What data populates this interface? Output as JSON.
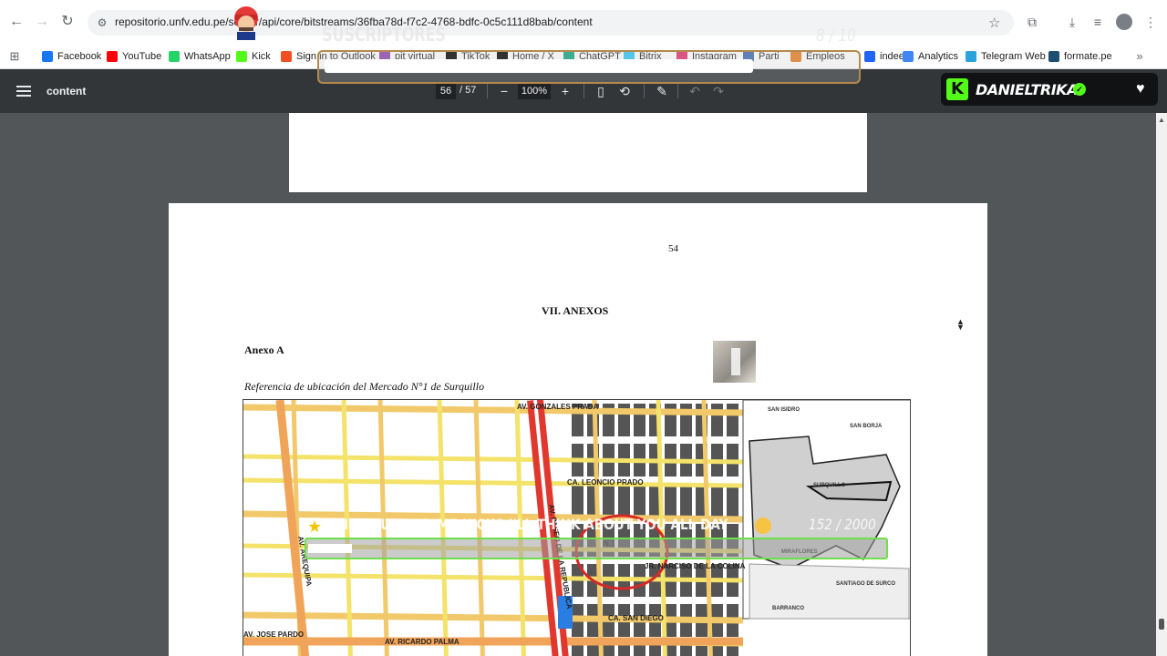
{
  "browser": {
    "url": "repositorio.unfv.edu.pe/server/api/core/bitstreams/36fba78d-f7c2-4768-bdfc-0c5c111d8bab/content",
    "bookmarks": [
      "Facebook",
      "YouTube",
      "WhatsApp",
      "Kick",
      "Sign in to Outlook",
      "pit virtual",
      "TikTok",
      "Home / X",
      "ChatGPT",
      "Bitrix",
      "Instagram",
      "Parti",
      "Empleos",
      "indeed",
      "Analytics",
      "Telegram Web",
      "formate.pe"
    ],
    "bookmark_colors": [
      "#1877f2",
      "#ff0000",
      "#25d366",
      "#53fc18",
      "#f25022",
      "#8e44ad",
      "#000000",
      "#000000",
      "#10a37f",
      "#2fc6f6",
      "#e1306c",
      "#3d6ab3",
      "#e67e22",
      "#2164f3",
      "#4285f4",
      "#2aa3df",
      "#1d4e72"
    ]
  },
  "pdf": {
    "title": "content",
    "current_page": "56",
    "total_pages": "/ 57",
    "zoom": "100%"
  },
  "document": {
    "page_number": "54",
    "section_title": "VII. ANEXOS",
    "annex_label": "Anexo A",
    "figure_caption": "Referencia de ubicación del Mercado N°1 de Surquillo"
  },
  "map": {
    "street_labels": [
      "AV. GONZALES PRADA",
      "CA. LEONCIO PRADO",
      "AV. PASEO DE LA REPUBLICA",
      "JR. NARCISO DE LA COLINA",
      "CA. SAN DIEGO",
      "AV. RICARDO PALMA",
      "AV. JOSE PARDO",
      "AV. AREQUIPA",
      "N.1"
    ],
    "district_labels": [
      "SAN ISIDRO",
      "SAN BORJA",
      "SURQUILLO",
      "MIRAFLORES",
      "SANTIAGO DE SURCO",
      "BARRANCO"
    ],
    "colors": {
      "major_road": "#e0382f",
      "avenue": "#f2c96a",
      "secondary": "#f4e36a",
      "block": "#555555"
    }
  },
  "overlays": {
    "subscribers_label": "SUSCRIPTORES",
    "subscribers_count": "8 / 10",
    "subscribers_progress": 0.8,
    "streamer_name": "DANIELTRIKA",
    "kicks_message": "\"IF YOU SEND ME KICKS I'LL THINK ABOUT YOU ALL DAY",
    "kicks_count": "152 / 2000",
    "kicks_progress": 0.076,
    "accent": "#53fc18"
  }
}
